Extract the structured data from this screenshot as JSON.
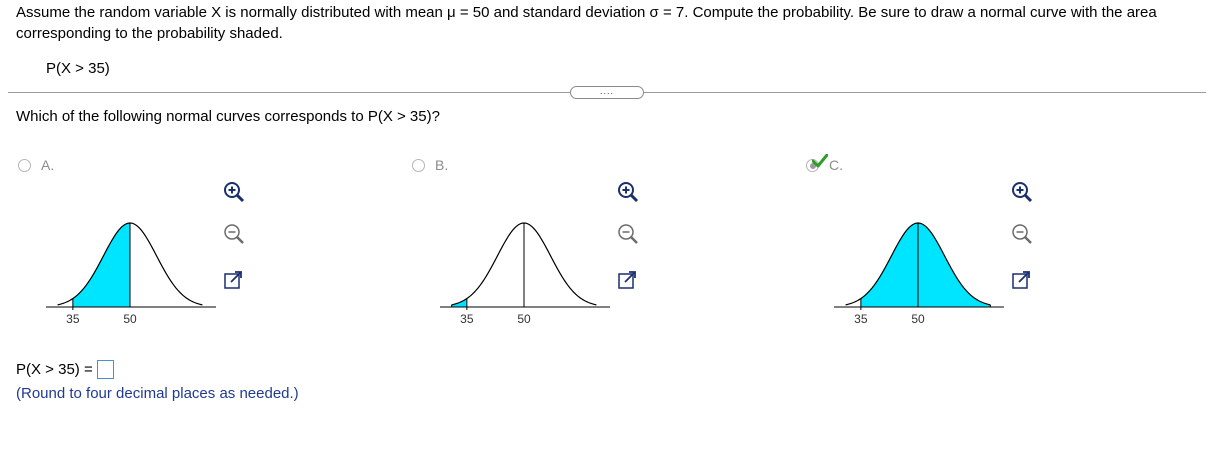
{
  "question": "Assume the random variable X is normally distributed with mean μ = 50 and standard deviation σ = 7. Compute the probability. Be sure to draw a normal curve with the area corresponding to the probability shaded.",
  "probability_expression": "P(X > 35)",
  "more_button_label": "....",
  "subquestion": "Which of the following normal curves corresponds to P(X > 35)?",
  "options": [
    {
      "label": "A.",
      "selected": false,
      "correct": false,
      "shade": "35-50",
      "ticks": [
        "35",
        "50"
      ]
    },
    {
      "label": "B.",
      "selected": false,
      "correct": false,
      "shade": "left-of-35",
      "ticks": [
        "35",
        "50"
      ]
    },
    {
      "label": "C.",
      "selected": true,
      "correct": true,
      "shade": "right-of-35",
      "ticks": [
        "35",
        "50"
      ]
    }
  ],
  "answer": {
    "prompt": "P(X > 35) =",
    "value": "",
    "note": "(Round to four decimal places as needed.)"
  },
  "colors": {
    "shade": "#00e5ff",
    "check": "#2a9d2a",
    "note": "#1f3a93",
    "input_border": "#4a8fd6",
    "icon_blue": "#1a2f6e"
  },
  "icons": [
    "zoom-in-icon",
    "zoom-out-icon",
    "expand-icon",
    "checkmark-icon"
  ]
}
